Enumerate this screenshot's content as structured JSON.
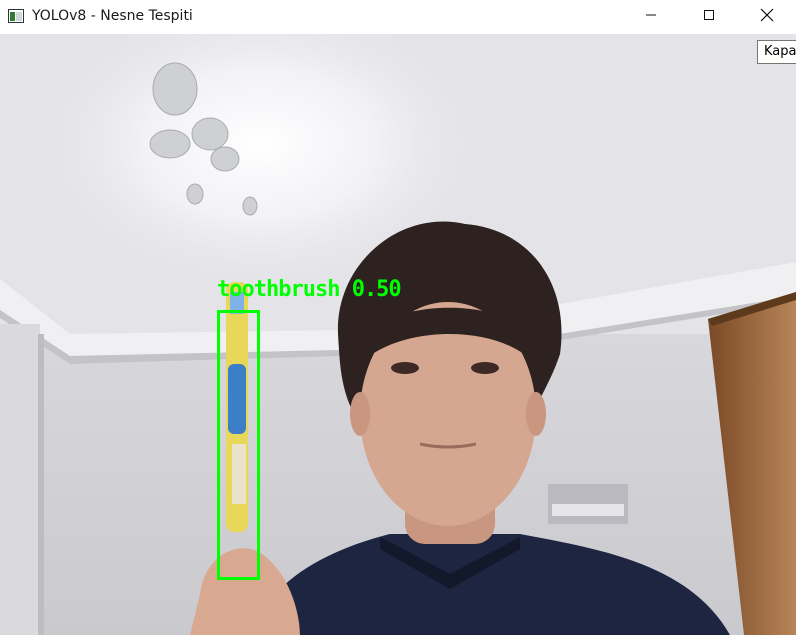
{
  "window": {
    "title": "YOLOv8 - Nesne Tespiti",
    "tooltip": "Kapat"
  },
  "icons": {
    "app": "opencv-window-icon",
    "minimize": "minimize-icon",
    "maximize": "maximize-icon",
    "close": "close-icon"
  },
  "detection": {
    "class": "toothbrush",
    "confidence": "0.50",
    "label": "toothbrush 0.50",
    "box_color": "#00ff00"
  }
}
